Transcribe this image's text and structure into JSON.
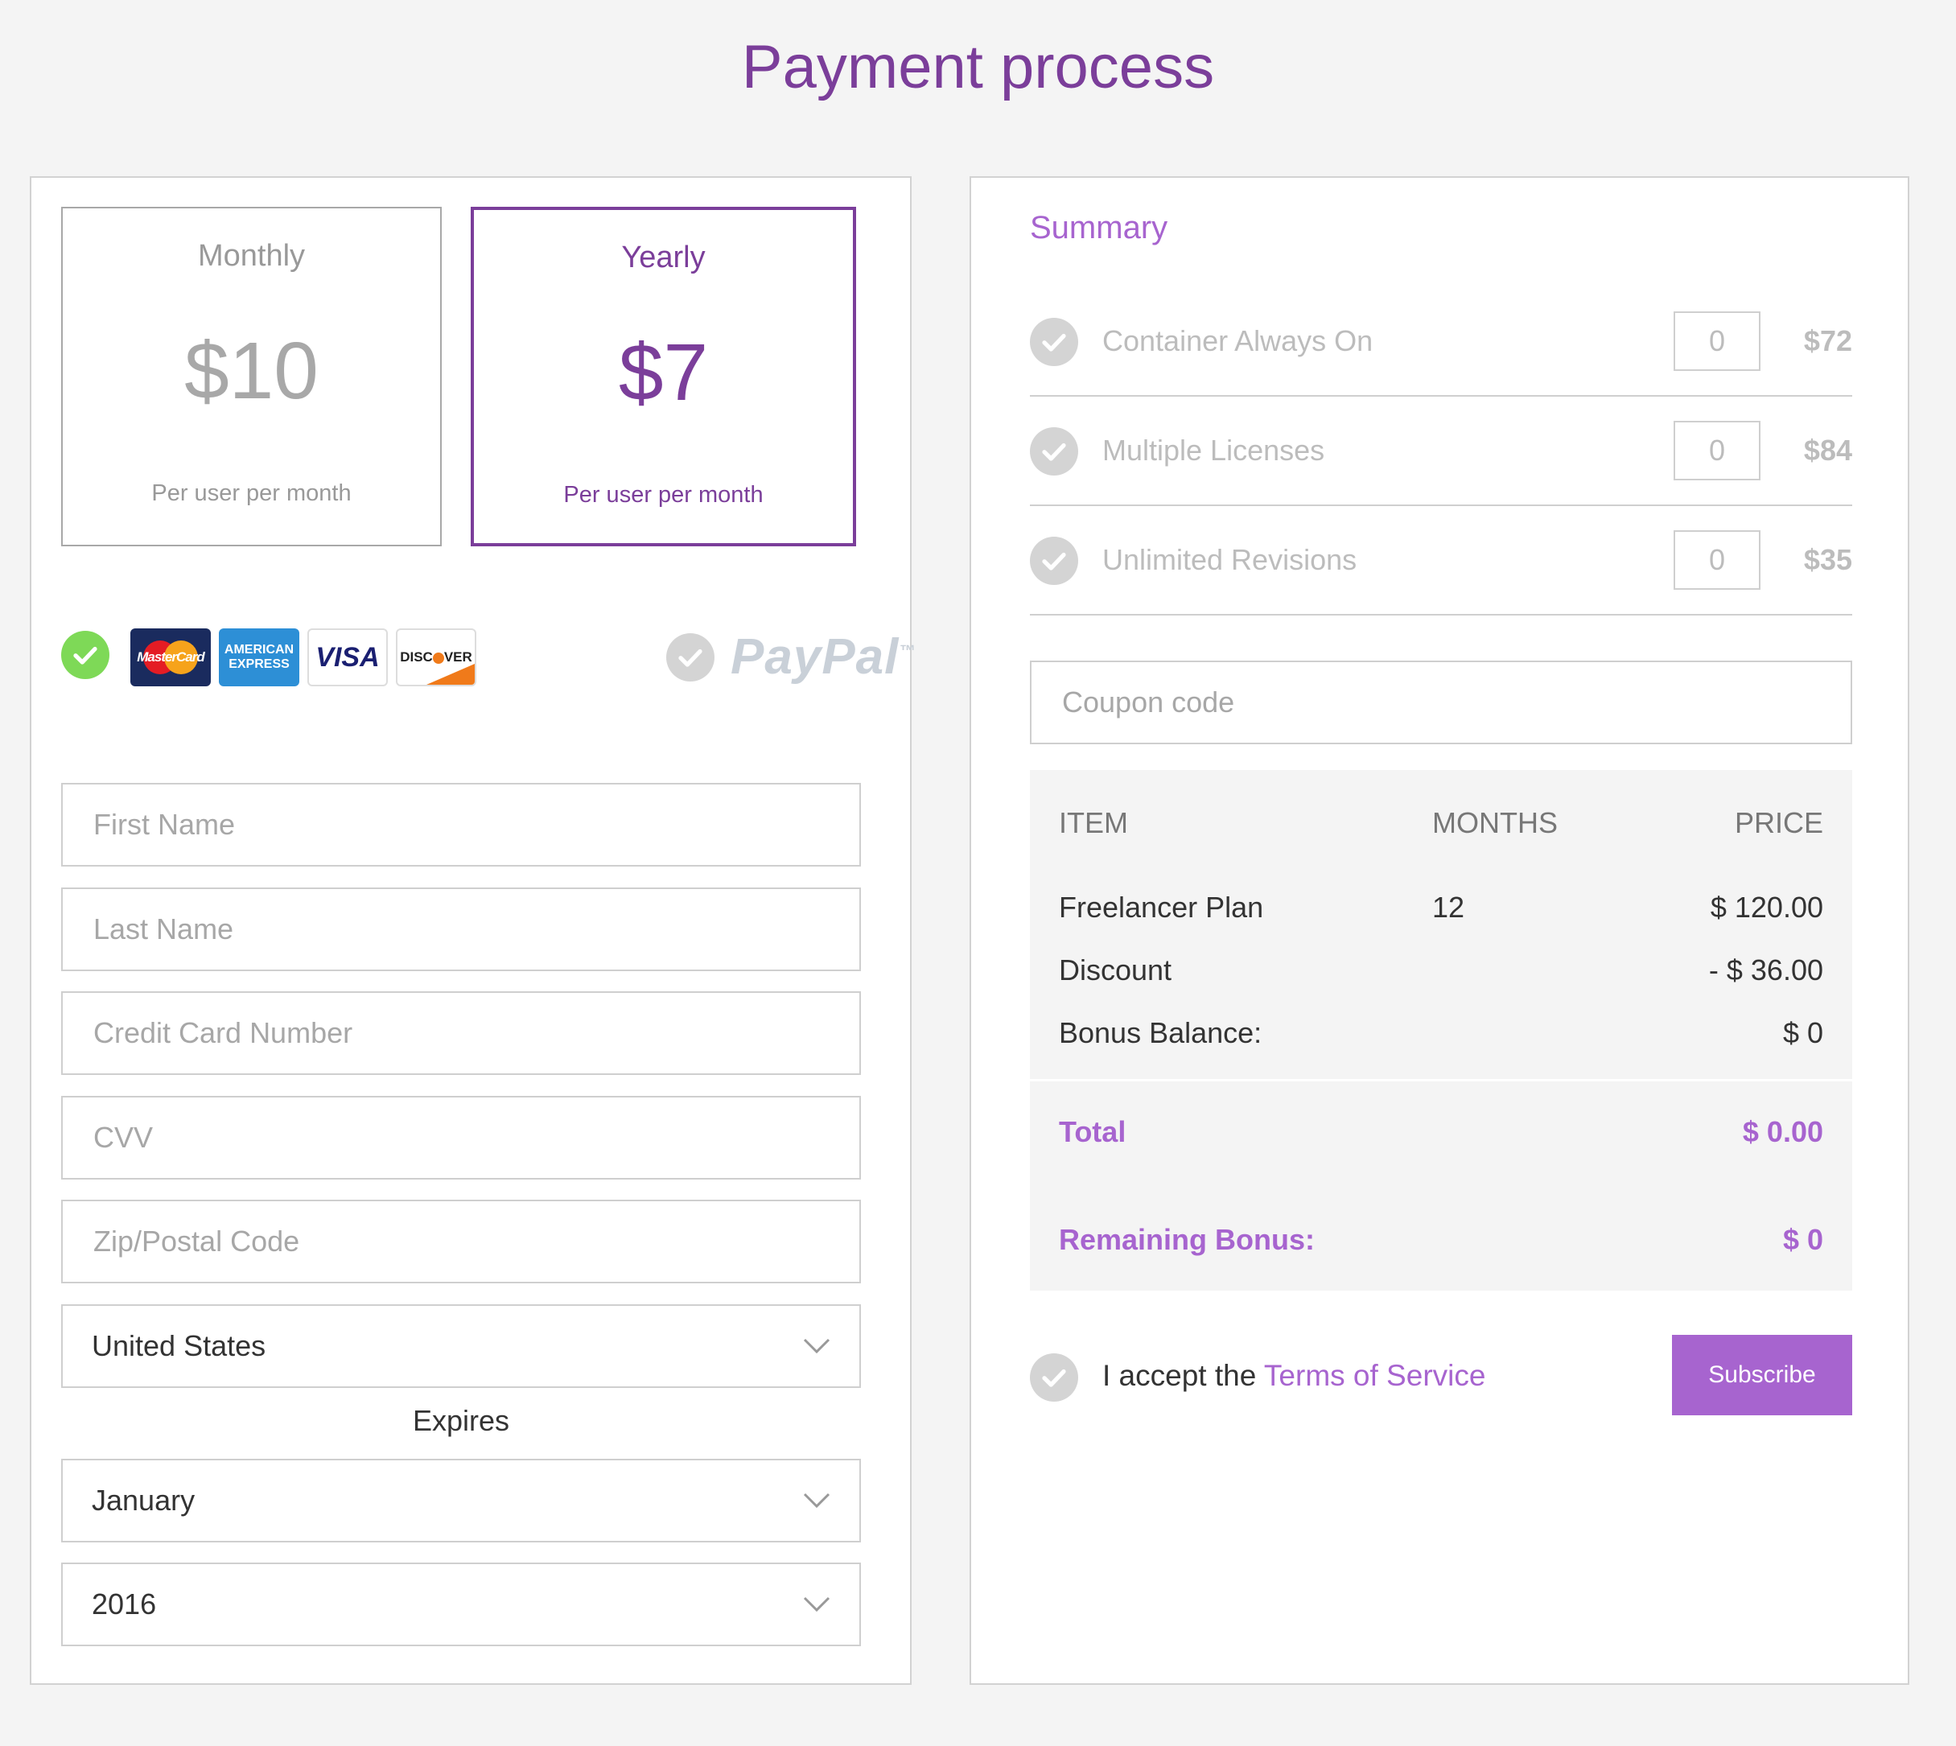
{
  "page": {
    "title": "Payment process"
  },
  "plans": [
    {
      "name": "Monthly",
      "price": "$10",
      "note": "Per user per month"
    },
    {
      "name": "Yearly",
      "price": "$7",
      "note": "Per user per month"
    }
  ],
  "payment_methods": {
    "cards": [
      {
        "icon": "mastercard-logo",
        "text": "MasterCard"
      },
      {
        "icon": "amex-logo",
        "line1": "AMERICAN",
        "line2": "EXPRESS"
      },
      {
        "icon": "visa-logo",
        "text": "VISA"
      },
      {
        "icon": "discover-logo",
        "text_a": "DISC",
        "text_b": "VER"
      }
    ],
    "paypal": "PayPal",
    "paypal_tm": "™"
  },
  "form": {
    "first_name": "First Name",
    "last_name": "Last Name",
    "card_number": "Credit Card Number",
    "cvv": "CVV",
    "zip": "Zip/Postal Code",
    "country": "United States",
    "expires_label": "Expires",
    "month": "January",
    "year": "2016"
  },
  "summary": {
    "title": "Summary",
    "addons": [
      {
        "label": "Container Always On",
        "qty": "0",
        "price": "$72"
      },
      {
        "label": "Multiple Licenses",
        "qty": "0",
        "price": "$84"
      },
      {
        "label": "Unlimited Revisions",
        "qty": "0",
        "price": "$35"
      }
    ],
    "coupon_placeholder": "Coupon code",
    "table": {
      "headers": {
        "item": "ITEM",
        "months": "MONTHS",
        "price": "PRICE"
      },
      "rows": [
        {
          "item": "Freelancer Plan",
          "months": "12",
          "price": "$ 120.00"
        },
        {
          "item": "Discount",
          "months": "",
          "price": "- $ 36.00"
        },
        {
          "item": "Bonus Balance:",
          "months": "",
          "price": "$ 0"
        }
      ]
    },
    "total": {
      "label": "Total",
      "value": "$ 0.00"
    },
    "remaining": {
      "label": "Remaining Bonus:",
      "value": "$ 0"
    },
    "terms_prefix": "I accept the",
    "terms_link": "Terms of Service",
    "subscribe": "Subscribe"
  },
  "colors": {
    "accent": "#7b3e9a",
    "accent_light": "#a764cf",
    "check_green": "#7ed957",
    "check_grey": "#d4d4d4"
  }
}
